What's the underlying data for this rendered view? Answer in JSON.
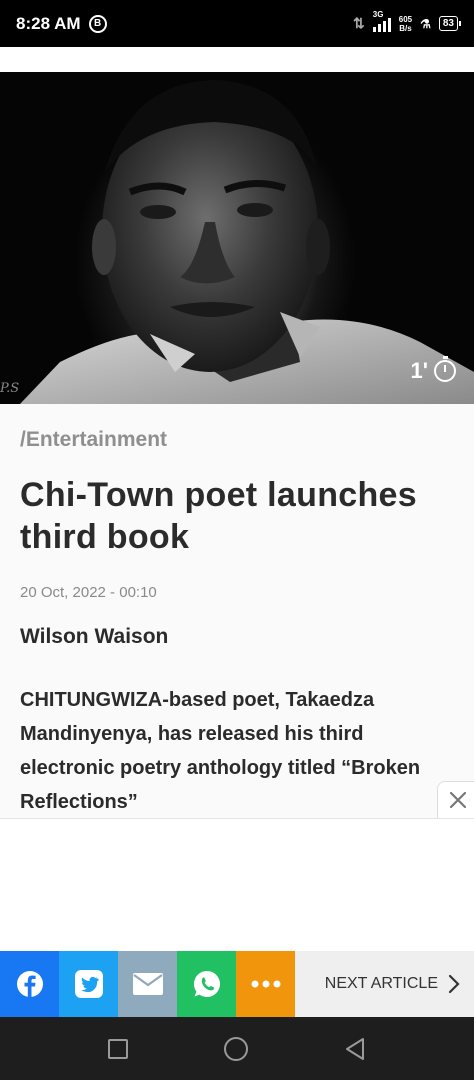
{
  "status_bar": {
    "time": "8:28 AM",
    "b_badge": "B",
    "network": "3G",
    "speed_value": "605",
    "speed_unit": "B/s",
    "battery": "83"
  },
  "hero": {
    "read_time": "1'",
    "photo_signature": "P.S"
  },
  "article": {
    "category": "/Entertainment",
    "headline": "Chi-Town poet launches third book",
    "date": "20 Oct, 2022 - 00:10",
    "author": "Wilson Waison",
    "body": "CHITUNGWIZA-based poet, Takaedza Mandinyenya, has released his third electronic poetry anthology titled “Broken Reflections”"
  },
  "share_bar": {
    "icons": [
      "facebook-icon",
      "twitter-icon",
      "mail-icon",
      "whatsapp-icon",
      "more-icon"
    ],
    "colors": [
      "#1877f2",
      "#1da1f2",
      "#8fa9bd",
      "#21c063",
      "#f0950c"
    ],
    "next_label": "NEXT ARTICLE"
  },
  "nav_bar": {
    "icons": [
      "recent-apps-icon",
      "home-icon",
      "back-icon"
    ]
  }
}
